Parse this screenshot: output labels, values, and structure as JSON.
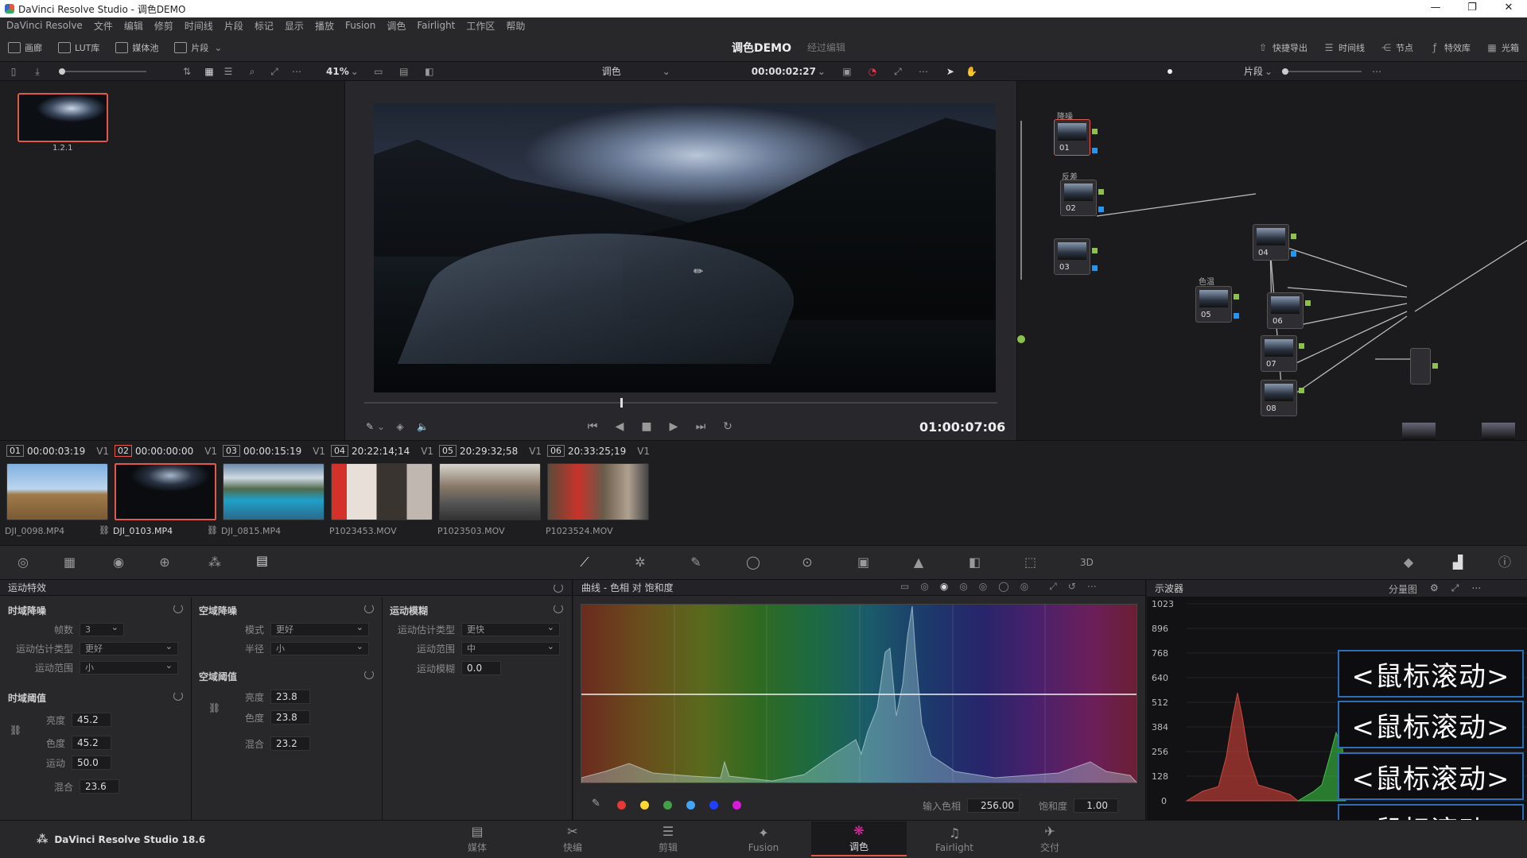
{
  "window": {
    "title": "DaVinci Resolve Studio - 调色DEMO",
    "controls": [
      "—",
      "❐",
      "✕"
    ]
  },
  "menu": [
    "DaVinci Resolve",
    "文件",
    "编辑",
    "修剪",
    "时间线",
    "片段",
    "标记",
    "显示",
    "播放",
    "Fusion",
    "调色",
    "Fairlight",
    "工作区",
    "帮助"
  ],
  "toolbar": {
    "gallery": "画廊",
    "lut": "LUT库",
    "media_pool": "媒体池",
    "clips": "片段",
    "project_title": "调色DEMO",
    "edit_status": "经过编辑",
    "quick_export": "快捷导出",
    "timeline": "时间线",
    "nodes": "节点",
    "effects": "特效库",
    "lightbox": "光箱"
  },
  "viewer_bar": {
    "zoom": "41%",
    "mode": "调色",
    "timecode": "00:00:02:27",
    "clips_mode": "片段"
  },
  "gallery": {
    "still_label": "1.2.1"
  },
  "transport": {
    "timecode": "01:00:07:06"
  },
  "clips": [
    {
      "num": "01",
      "tc": "00:00:03:19",
      "track": "V1",
      "name": "DJI_0098.MP4",
      "linked": false
    },
    {
      "num": "02",
      "tc": "00:00:00:00",
      "track": "V1",
      "name": "DJI_0103.MP4",
      "linked": true
    },
    {
      "num": "03",
      "tc": "00:00:15:19",
      "track": "V1",
      "name": "DJI_0815.MP4",
      "linked": true
    },
    {
      "num": "04",
      "tc": "20:22:14;14",
      "track": "V1",
      "name": "P1023453.MOV",
      "linked": false
    },
    {
      "num": "05",
      "tc": "20:29:32;58",
      "track": "V1",
      "name": "P1023503.MOV",
      "linked": false
    },
    {
      "num": "06",
      "tc": "20:33:25;19",
      "track": "V1",
      "name": "P1023524.MOV",
      "linked": false
    }
  ],
  "motion": {
    "title": "运动特效",
    "temporal": {
      "title": "时域降噪",
      "frames_label": "帧数",
      "frames": "3",
      "est_label": "运动估计类型",
      "est": "更好",
      "range_label": "运动范围",
      "range": "小"
    },
    "temporal_thr": {
      "title": "时域阈值",
      "luma_label": "亮度",
      "luma": "45.2",
      "chroma_label": "色度",
      "chroma": "45.2",
      "motion_label": "运动",
      "motion": "50.0",
      "blend_label": "混合",
      "blend": "23.6"
    },
    "spatial": {
      "title": "空域降噪",
      "mode_label": "模式",
      "mode": "更好",
      "radius_label": "半径",
      "radius": "小"
    },
    "spatial_thr": {
      "title": "空域阈值",
      "luma_label": "亮度",
      "luma": "23.8",
      "chroma_label": "色度",
      "chroma": "23.8",
      "blend_label": "混合",
      "blend": "23.2"
    },
    "blur": {
      "title": "运动模糊",
      "est_label": "运动估计类型",
      "est": "更快",
      "range_label": "运动范围",
      "range": "中",
      "amount_label": "运动模糊",
      "amount": "0.0"
    }
  },
  "curves": {
    "title": "曲线 - 色相 对 饱和度",
    "input_hue_label": "输入色相",
    "input_hue": "256.00",
    "sat_label": "饱和度",
    "sat": "1.00",
    "swatches": [
      "#e53935",
      "#fdd835",
      "#43a047",
      "#42a5f5",
      "#1e40ff",
      "#d81bd8"
    ]
  },
  "scope": {
    "title": "示波器",
    "mode": "分量图",
    "ticks": [
      "1023",
      "896",
      "768",
      "640",
      "512",
      "384",
      "256",
      "128",
      "0"
    ]
  },
  "overlay": {
    "text": "<鼠标滚动>"
  },
  "nodes": {
    "labels": {
      "n01": "降噪",
      "n02": "反差",
      "n05": "色温"
    },
    "ids": [
      "01",
      "02",
      "03",
      "04",
      "05",
      "06",
      "07",
      "08"
    ]
  },
  "pagebar": {
    "app_name": "DaVinci Resolve Studio 18.6",
    "pages": [
      "媒体",
      "快编",
      "剪辑",
      "Fusion",
      "调色",
      "Fairlight",
      "交付"
    ],
    "active": "调色"
  }
}
